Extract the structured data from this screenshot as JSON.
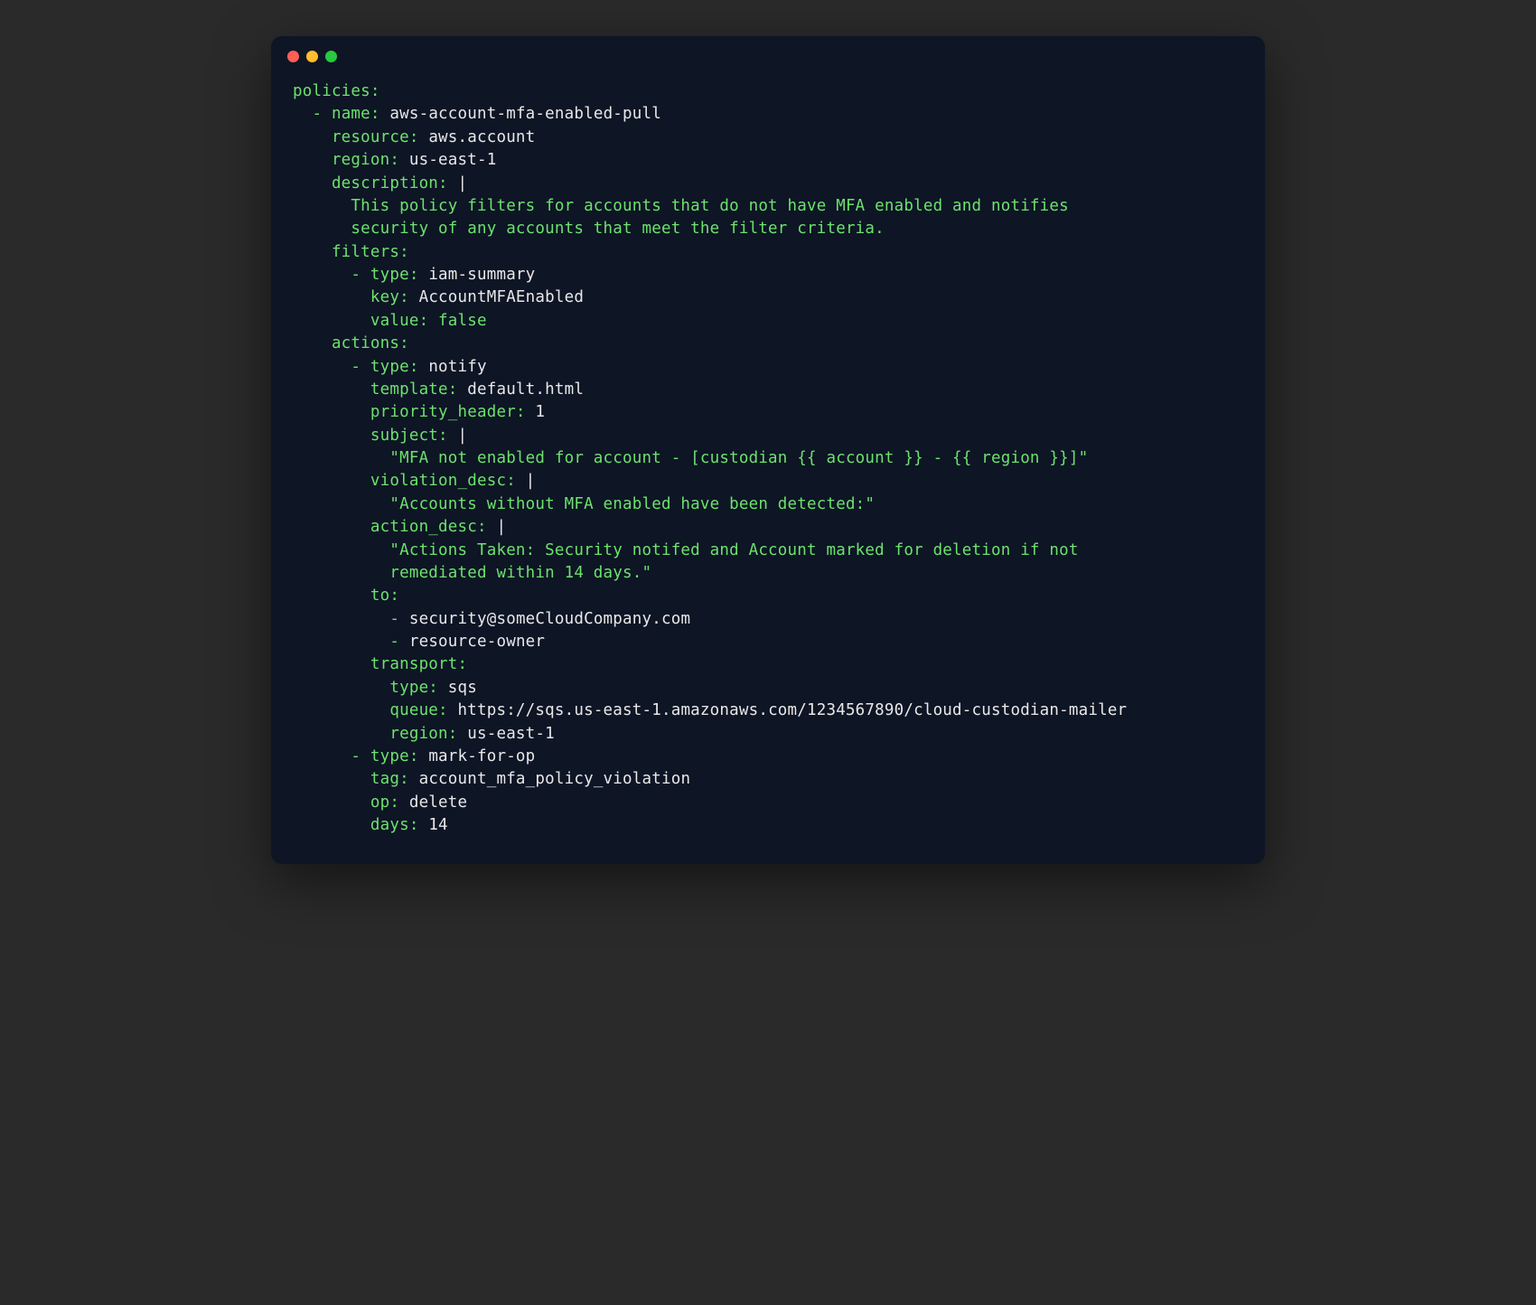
{
  "code": {
    "l1_policies": "policies:",
    "l2_dash": "  - ",
    "l2_name_k": "name: ",
    "l2_name_v": "aws-account-mfa-enabled-pull",
    "l3_resource_k": "    resource: ",
    "l3_resource_v": "aws.account",
    "l4_region_k": "    region: ",
    "l4_region_v": "us-east-1",
    "l5_description_k": "    description: ",
    "l5_description_pipe": "|",
    "l6_desc_body1": "      This policy filters for accounts that do not have MFA enabled and notifies",
    "l7_desc_body2": "      security of any accounts that meet the filter criteria.",
    "l8_filters": "    filters:",
    "l9_dash": "      - ",
    "l9_type_k": "type: ",
    "l9_type_v": "iam-summary",
    "l10_key_k": "        key: ",
    "l10_key_v": "AccountMFAEnabled",
    "l11_value_k": "        value: ",
    "l11_value_v": "false",
    "l12_actions": "    actions:",
    "l13_dash": "      - ",
    "l13_type_k": "type: ",
    "l13_type_v": "notify",
    "l14_template_k": "        template: ",
    "l14_template_v": "default.html",
    "l15_priority_k": "        priority_header: ",
    "l15_priority_v": "1",
    "l16_subject_k": "        subject: ",
    "l16_subject_pipe": "|",
    "l17_subject_body": "          \"MFA not enabled for account - [custodian {{ account }} - {{ region }}]\"",
    "l18_viol_k": "        violation_desc: ",
    "l18_viol_pipe": "|",
    "l19_viol_body": "          \"Accounts without MFA enabled have been detected:\"",
    "l20_action_k": "        action_desc: ",
    "l20_action_pipe": "|",
    "l21_action_body1": "          \"Actions Taken: Security notifed and Account marked for deletion if not",
    "l22_action_body2": "          remediated within 14 days.\"",
    "l23_to": "        to:",
    "l24_to_dash": "          - ",
    "l24_to_v": "security@someCloudCompany.com",
    "l25_to_dash": "          - ",
    "l25_to_v": "resource-owner",
    "l26_transport": "        transport:",
    "l27_ttype_k": "          type: ",
    "l27_ttype_v": "sqs",
    "l28_queue_k": "          queue: ",
    "l28_queue_v": "https://sqs.us-east-1.amazonaws.com/1234567890/cloud-custodian-mailer",
    "l29_tregion_k": "          region: ",
    "l29_tregion_v": "us-east-1",
    "l30_dash": "      - ",
    "l30_type_k": "type: ",
    "l30_type_v": "mark-for-op",
    "l31_tag_k": "        tag: ",
    "l31_tag_v": "account_mfa_policy_violation",
    "l32_op_k": "        op: ",
    "l32_op_v": "delete",
    "l33_days_k": "        days: ",
    "l33_days_v": "14"
  }
}
